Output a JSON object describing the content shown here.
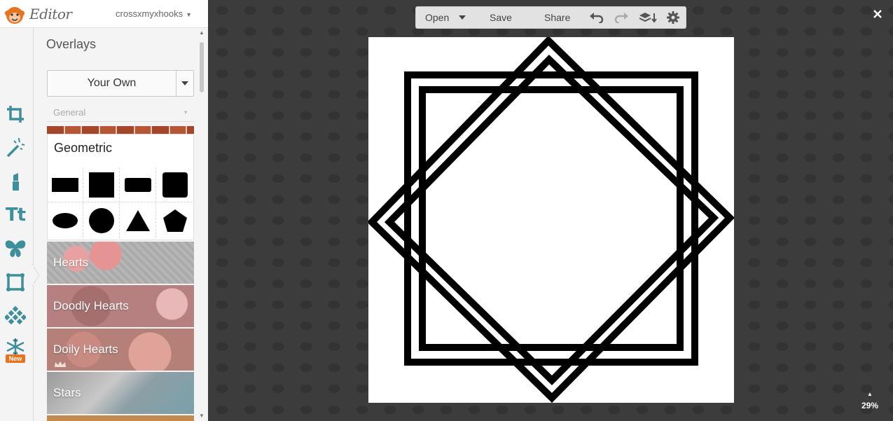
{
  "app": {
    "name": "Editor",
    "username": "crossxmyxhooks"
  },
  "icons": {
    "logo": "monkey-logo-icon",
    "rail": [
      "crop-icon",
      "magic-wand-icon",
      "lipstick-icon",
      "text-icon",
      "butterfly-icon",
      "frame-icon",
      "texture-icon",
      "snowflake-icon"
    ]
  },
  "rail": {
    "new_badge": "New"
  },
  "overlays": {
    "title": "Overlays",
    "source_button": "Your Own",
    "category_select": "General",
    "geometric": {
      "title": "Geometric",
      "shapes": [
        "rectangle",
        "square",
        "rounded-rectangle",
        "rounded-square",
        "ellipse",
        "circle",
        "triangle",
        "pentagon"
      ]
    },
    "categories": [
      "Hearts",
      "Doodly Hearts",
      "Doily Hearts",
      "Stars"
    ]
  },
  "toolbar": {
    "open": "Open",
    "save": "Save",
    "share": "Share"
  },
  "zoom": {
    "level": "29%"
  },
  "colors": {
    "accent_teal": "#3e8f9c",
    "badge_orange": "#e8731f",
    "logo_orange": "#e8731f"
  }
}
